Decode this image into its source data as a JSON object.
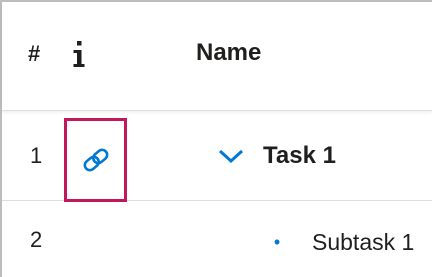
{
  "header": {
    "num_label": "#",
    "info_icon": "info-icon",
    "name_label": "Name"
  },
  "rows": [
    {
      "number": "1",
      "link_icon": "link-icon",
      "expand_icon": "chevron-down-icon",
      "name": "Task 1"
    },
    {
      "number": "2",
      "bullet": "•",
      "name": "Subtask 1"
    }
  ],
  "colors": {
    "accent": "#0078d4",
    "highlight_border": "#c2185b",
    "divider": "#e1dfdd",
    "text": "#201f1e"
  }
}
